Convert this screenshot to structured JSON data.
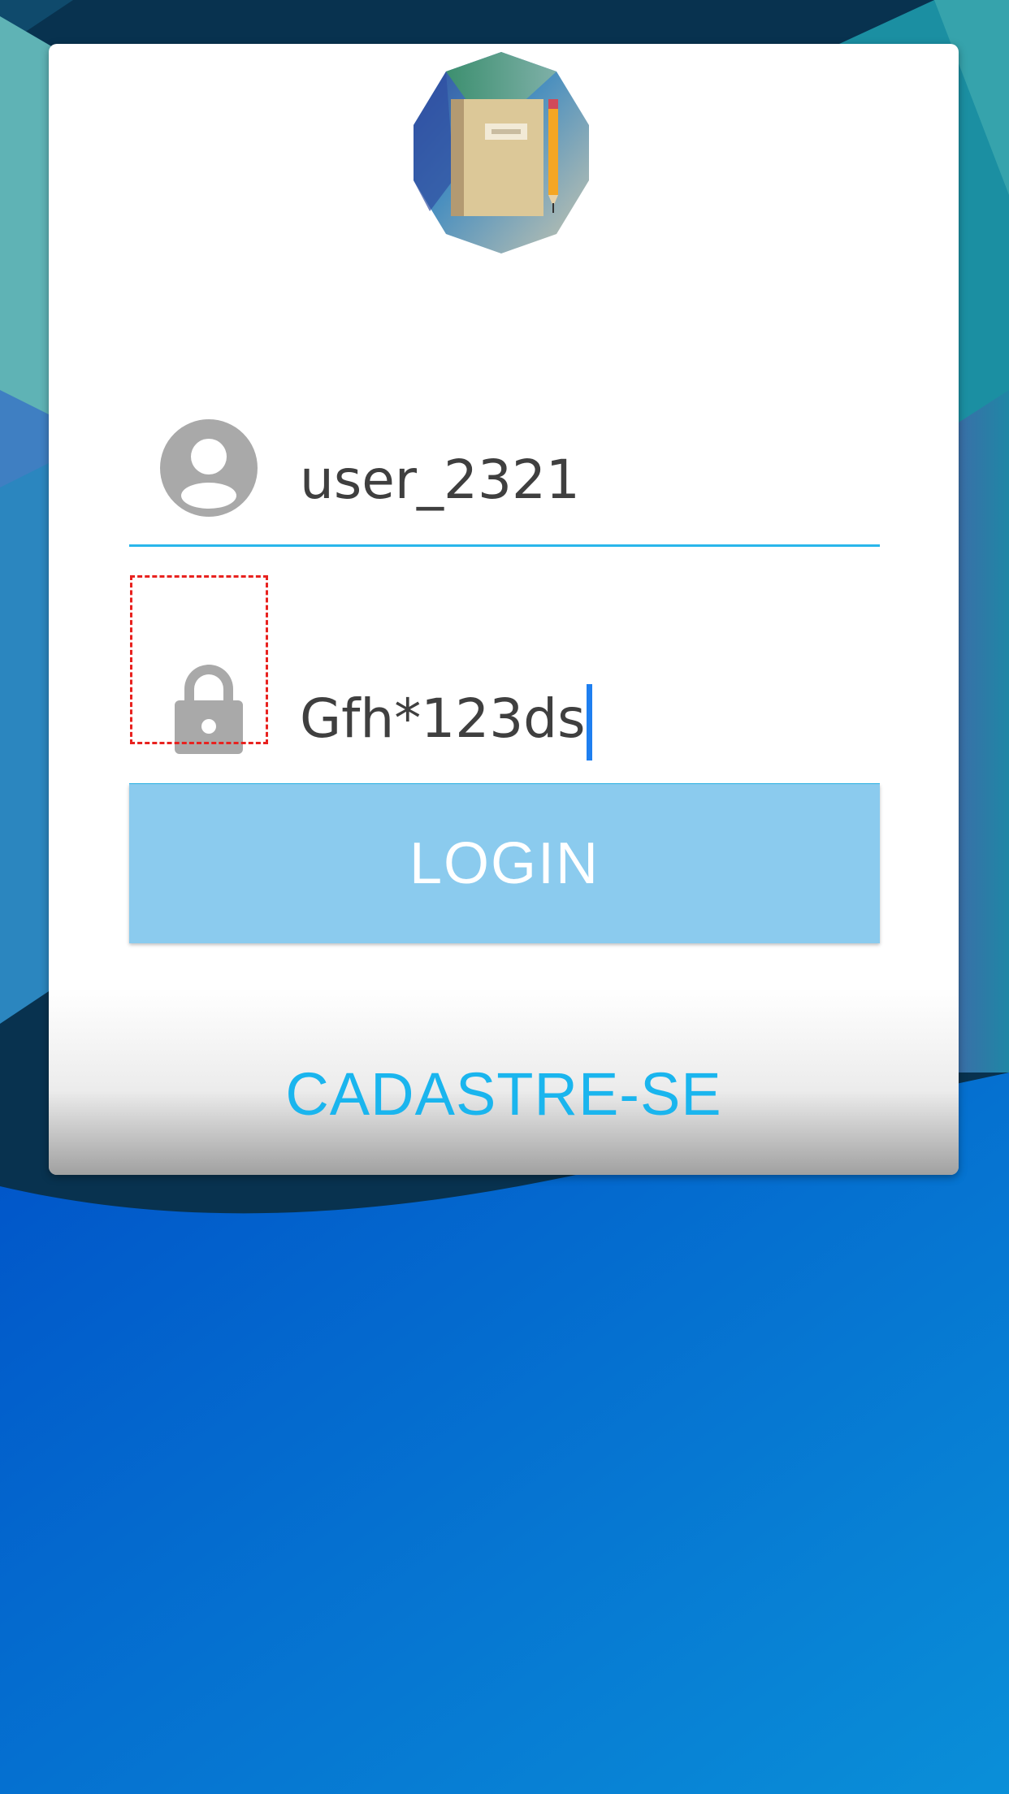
{
  "colors": {
    "accent": "#29b6ea",
    "button_bg": "#8bcbee",
    "link": "#1ab5ee",
    "icon": "#a9a9a9",
    "text": "#3f3f3f",
    "caret": "#1e7ff0",
    "background_blue": "#0a66cc"
  },
  "logo": {
    "icon": "notebook-pencil-icon"
  },
  "login_form": {
    "username": {
      "icon": "account-circle-icon",
      "value": "user_2321"
    },
    "password": {
      "icon": "lock-icon",
      "value": "Gfh*123ds"
    },
    "login_button": "LOGIN",
    "signup_link": "CADASTRE-SE"
  }
}
